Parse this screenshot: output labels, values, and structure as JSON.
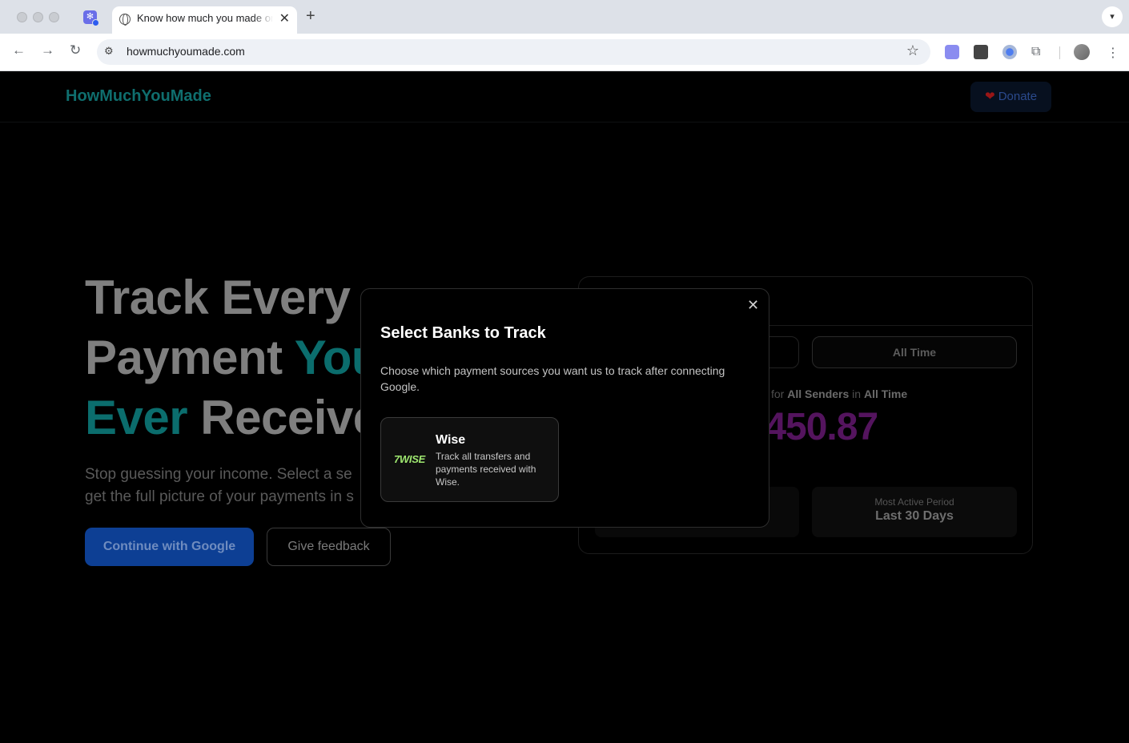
{
  "browser": {
    "tab_title": "Know how much you made on",
    "url": "howmuchyoumade.com"
  },
  "header": {
    "logo": "HowMuchYouMade",
    "donate_label": "Donate",
    "donate_icon": "heart-icon"
  },
  "hero": {
    "title_line1": "Track Every",
    "title_line2_a": "Payment ",
    "title_line2_b": "You",
    "title_line3_a": "Ever",
    "title_line3_b": " Receive",
    "subtitle_line1": "Stop guessing your income. Select a se",
    "subtitle_line2": "get the full picture of your payments in s",
    "cta_google": "Continue with Google",
    "cta_feedback": "Give feedback"
  },
  "preview": {
    "period_all": "All Time",
    "summary_for": "for ",
    "summary_senders": "All Senders",
    "summary_in": " in ",
    "summary_period": "All Time",
    "amount": ",450.87",
    "stat_label": "Most Active Period",
    "stat_value": "Last 30 Days"
  },
  "modal": {
    "title": "Select Banks to Track",
    "description": "Choose which payment sources you want us to track after connecting Google.",
    "close_icon": "close-icon",
    "banks": [
      {
        "logo_text": "7WISE",
        "name": "Wise",
        "description": "Track all transfers and payments received with Wise."
      }
    ]
  },
  "colors": {
    "accent_teal": "#0f6e6e",
    "modal_bg": "#000000",
    "amount_purple": "#54145e",
    "wise_green": "#9fe870"
  }
}
